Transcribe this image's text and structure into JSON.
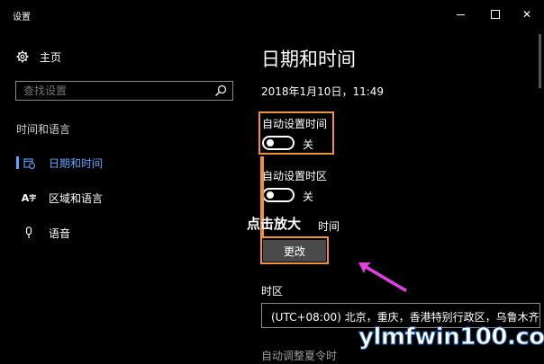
{
  "window": {
    "title": "设置"
  },
  "sidebar": {
    "home_label": "主页",
    "search_placeholder": "查找设置",
    "section_label": "时间和语言",
    "items": [
      {
        "label": "日期和时间",
        "icon": "calendar-clock-icon",
        "active": true
      },
      {
        "label": "区域和语言",
        "icon": "language-icon",
        "active": false
      },
      {
        "label": "语音",
        "icon": "microphone-icon",
        "active": false
      }
    ]
  },
  "main": {
    "title": "日期和时间",
    "current_datetime": "2018年1月10日，11:49",
    "auto_time": {
      "label": "自动设置时间",
      "state": "关"
    },
    "auto_timezone": {
      "label": "自动设置时区",
      "state": "关"
    },
    "change_time_label_partial": "时间",
    "change_button": "更改",
    "timezone": {
      "label": "时区",
      "value": "(UTC+08:00) 北京，重庆，香港特别行政区，乌鲁木齐"
    },
    "dst_label": "自动调整夏令时"
  },
  "overlay": {
    "zoom_hint": "点击放大"
  },
  "watermark": {
    "text": "ylmfwin100.com"
  },
  "colors": {
    "accent": "#5aa6ff",
    "highlight": "#f0913a",
    "arrow": "#e040e0"
  }
}
